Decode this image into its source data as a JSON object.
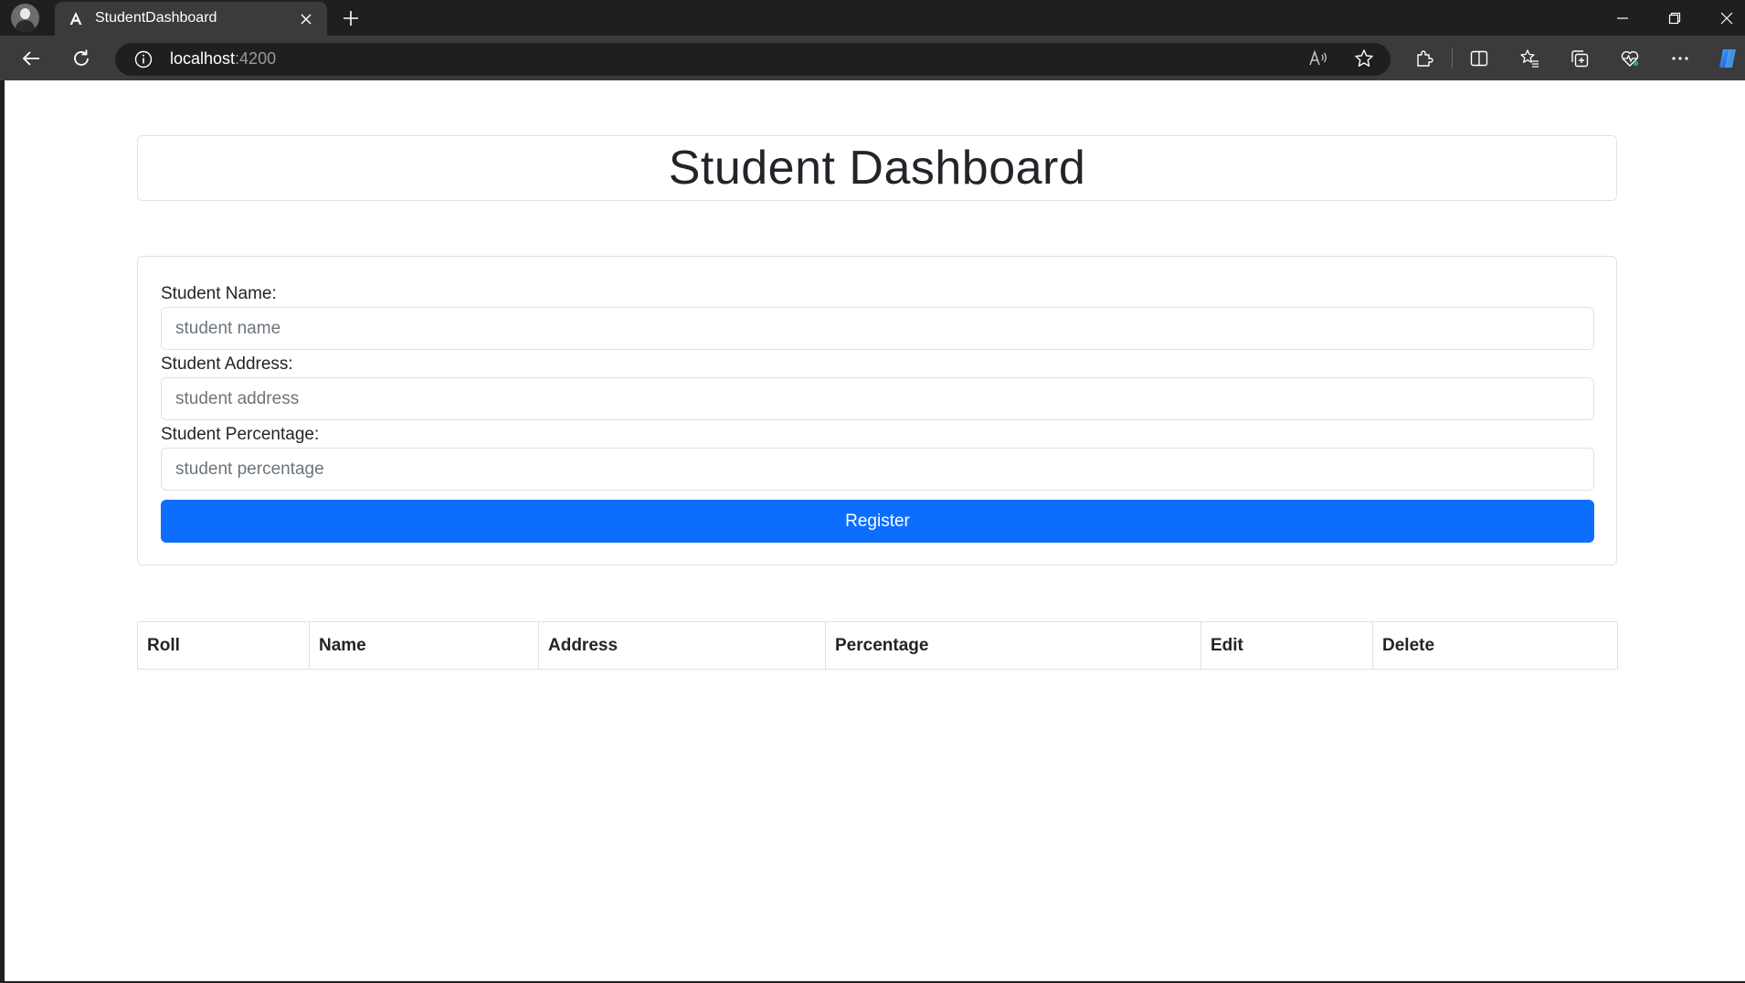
{
  "browser": {
    "tab_title": "StudentDashboard",
    "url_host": "localhost",
    "url_port": ":4200"
  },
  "page": {
    "title": "Student Dashboard"
  },
  "form": {
    "name_label": "Student Name:",
    "name_placeholder": "student name",
    "name_value": "",
    "address_label": "Student Address:",
    "address_placeholder": "student address",
    "address_value": "",
    "percentage_label": "Student Percentage:",
    "percentage_placeholder": "student percentage",
    "percentage_value": "",
    "register_label": "Register"
  },
  "table": {
    "headers": [
      "Roll",
      "Name",
      "Address",
      "Percentage",
      "Edit",
      "Delete"
    ],
    "rows": []
  },
  "colors": {
    "primary": "#0d6efd",
    "border": "#dee2e6",
    "text": "#212529",
    "chrome_dark": "#1f1f1f",
    "chrome_toolbar": "#3b3b3b"
  },
  "icons": {
    "tab_favicon": "angular-icon",
    "nav": [
      "back-arrow-icon",
      "refresh-icon",
      "info-icon"
    ],
    "toolbar_right": [
      "read-aloud-icon",
      "favorite-star-icon",
      "extensions-icon",
      "split-screen-icon",
      "favorites-icon",
      "collections-icon",
      "browser-essentials-icon",
      "more-icon",
      "copilot-icon"
    ],
    "window": [
      "minimize-icon",
      "restore-icon",
      "close-icon"
    ]
  }
}
